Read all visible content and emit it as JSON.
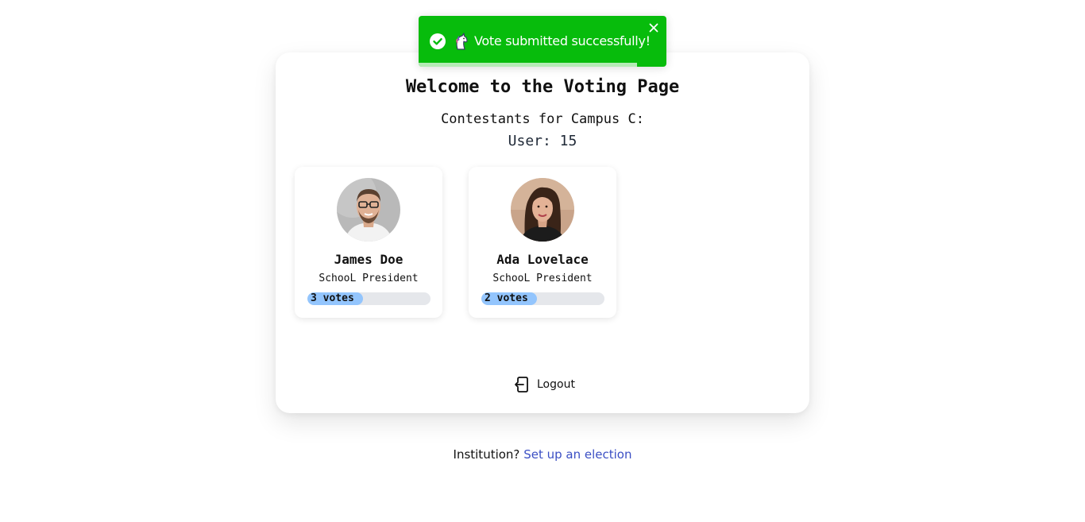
{
  "page": {
    "title": "Welcome to the Voting Page",
    "subtitle": "Contestants for Campus C:",
    "user_line": "User: 15"
  },
  "contestants": [
    {
      "name": "James Doe",
      "role": "SchooL President",
      "votes_label": "3 votes",
      "vote_share": 0.45,
      "avatar": "photo-man-glasses"
    },
    {
      "name": "Ada Lovelace",
      "role": "SchooL President",
      "votes_label": "2 votes",
      "vote_share": 0.45,
      "avatar": "photo-woman"
    }
  ],
  "logout": {
    "label": "Logout",
    "icon": "logout-icon"
  },
  "footer": {
    "prompt": "Institution?",
    "link_text": "Set up an election"
  },
  "toast": {
    "message": "Vote submitted successfully!",
    "status_icon": "check-circle-icon",
    "emoji_icon": "unicorn-icon",
    "close_icon": "close-icon",
    "background": "#07bc0c",
    "progress_remaining": 0.88
  },
  "colors": {
    "bar_fill": "#93c5fd",
    "bar_track": "#e5e7eb",
    "link": "#3b4fc4"
  }
}
